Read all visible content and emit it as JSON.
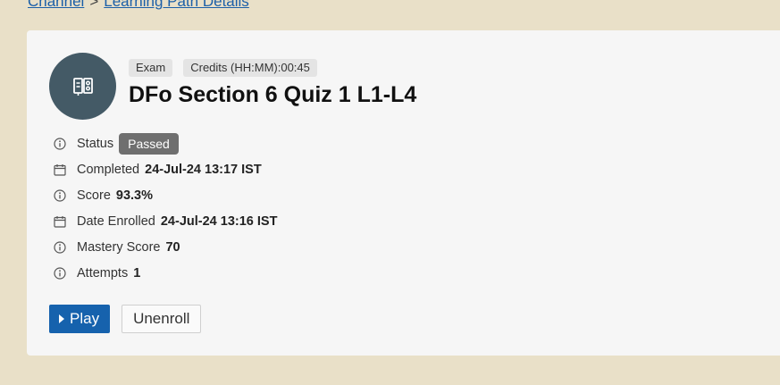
{
  "breadcrumb": {
    "items": [
      "Channel",
      "Learning Path Details"
    ],
    "separator": ">"
  },
  "course": {
    "icon": "exam-icon",
    "tags": [
      "Exam",
      "Credits (HH:MM):00:45"
    ],
    "title": "DFo Section 6 Quiz 1 L1-L4"
  },
  "details": [
    {
      "icon": "info-icon",
      "label": "Status",
      "value": "Passed",
      "type": "badge"
    },
    {
      "icon": "calendar-icon",
      "label": "Completed",
      "value": "24-Jul-24 13:17 IST"
    },
    {
      "icon": "info-icon",
      "label": "Score",
      "value": "93.3%"
    },
    {
      "icon": "calendar-icon",
      "label": "Date Enrolled",
      "value": "24-Jul-24 13:16 IST"
    },
    {
      "icon": "info-icon",
      "label": "Mastery Score",
      "value": "70"
    },
    {
      "icon": "info-icon",
      "label": "Attempts",
      "value": "1"
    }
  ],
  "actions": {
    "play_label": "Play",
    "unenroll_label": "Unenroll"
  },
  "colors": {
    "page_background": "#e9e0c8",
    "card_background": "#f6f6f6",
    "primary": "#1662ad",
    "avatar": "#445a66",
    "badge": "#6f6f6f"
  }
}
